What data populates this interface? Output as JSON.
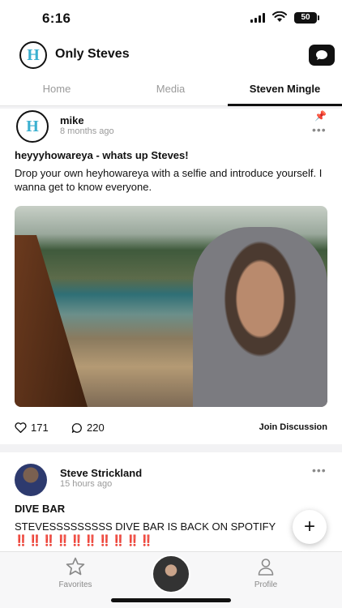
{
  "status": {
    "time": "6:16",
    "battery": "50"
  },
  "header": {
    "title": "Only Steves",
    "logo_letter": "H"
  },
  "tabs": [
    {
      "label": "Home"
    },
    {
      "label": "Media"
    },
    {
      "label": "Steven Mingle"
    }
  ],
  "posts": [
    {
      "author": "mike",
      "time": "8 months ago",
      "avatar_letter": "H",
      "title": "heyyyhowareya - whats up Steves!",
      "body": "Drop your own heyhowareya with a selfie and introduce yourself. I wanna get to know everyone.",
      "likes": "171",
      "comments": "220",
      "join_label": "Join Discussion",
      "more": "•••"
    },
    {
      "author": "Steve Strickland",
      "time": "15 hours ago",
      "title": "DIVE BAR",
      "body": "STEVESSSSSSSSS DIVE BAR IS BACK ON SPOTIFY",
      "emoji": "‼️‼️‼️‼️‼️‼️‼️‼️‼️‼️",
      "more": "•••"
    }
  ],
  "fab": {
    "label": "+"
  },
  "bottom_nav": {
    "favorites": "Favorites",
    "profile": "Profile"
  },
  "icons": {
    "pin": "pushpin-icon",
    "heart": "heart-icon",
    "comment": "comment-bubble-icon",
    "star": "star-icon",
    "person": "person-icon",
    "chat": "chat-bubble-icon"
  },
  "colors": {
    "logo_accent": "#3bb0d0",
    "emoji_red": "#e0242a"
  }
}
